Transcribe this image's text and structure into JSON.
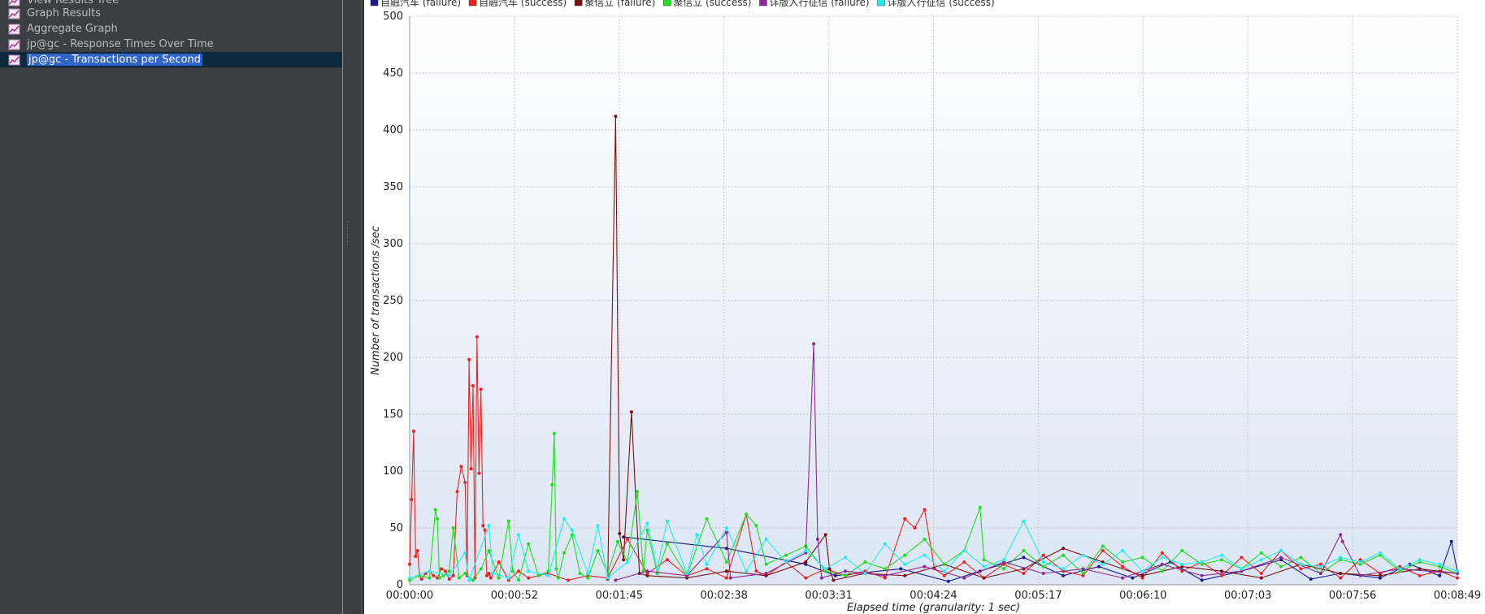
{
  "tree": {
    "items": [
      {
        "label": "View Results Tree",
        "selected": false
      },
      {
        "label": "Graph Results",
        "selected": false
      },
      {
        "label": "Aggregate Graph",
        "selected": false
      },
      {
        "label": "jp@gc - Response Times Over Time",
        "selected": false
      },
      {
        "label": "jp@gc - Transactions per Second",
        "selected": true
      }
    ]
  },
  "chart_data": {
    "type": "line",
    "xlabel": "Elapsed time (granularity: 1 sec)",
    "ylabel": "Number of transactions /sec",
    "ylim": [
      0,
      500
    ],
    "yticks": [
      0,
      50,
      100,
      150,
      200,
      250,
      300,
      350,
      400,
      450,
      500
    ],
    "xlim_seconds": [
      0,
      529
    ],
    "xticks": [
      "00:00:00",
      "00:00:52",
      "00:01:45",
      "00:02:38",
      "00:03:31",
      "00:04:24",
      "00:05:17",
      "00:06:10",
      "00:07:03",
      "00:07:56",
      "00:08:49"
    ],
    "grid": true,
    "legend_position": "top",
    "series": [
      {
        "name": "自融汽车 (failure)",
        "color": "#1a1a8c",
        "x": [
          108,
          160,
          200,
          215,
          248,
          272,
          288,
          310,
          330,
          348,
          365,
          384,
          400,
          420,
          440,
          455,
          470,
          490,
          505,
          520,
          526,
          529
        ],
        "y": [
          42,
          32,
          18,
          8,
          14,
          3,
          12,
          24,
          8,
          16,
          6,
          20,
          4,
          12,
          22,
          5,
          10,
          6,
          18,
          8,
          38,
          12
        ]
      },
      {
        "name": "自融汽车 (success)",
        "color": "#ee2222",
        "x": [
          0,
          1,
          2,
          3,
          4,
          5,
          6,
          8,
          10,
          12,
          14,
          16,
          18,
          20,
          22,
          24,
          26,
          28,
          29,
          30,
          31,
          32,
          33,
          34,
          35,
          36,
          37,
          38,
          39,
          40,
          41,
          45,
          50,
          55,
          60,
          70,
          80,
          90,
          100,
          110,
          120,
          130,
          140,
          150,
          160,
          170,
          175,
          180,
          190,
          200,
          210,
          220,
          230,
          240,
          250,
          255,
          260,
          265,
          270,
          280,
          290,
          300,
          310,
          320,
          330,
          340,
          350,
          360,
          370,
          380,
          390,
          400,
          410,
          420,
          430,
          440,
          450,
          460,
          470,
          480,
          490,
          500,
          510,
          520,
          529
        ],
        "y": [
          18,
          75,
          135,
          25,
          30,
          8,
          5,
          10,
          12,
          8,
          6,
          14,
          12,
          5,
          8,
          82,
          104,
          90,
          8,
          198,
          102,
          175,
          6,
          218,
          98,
          172,
          52,
          48,
          8,
          10,
          6,
          20,
          4,
          12,
          6,
          10,
          4,
          8,
          6,
          40,
          10,
          22,
          8,
          14,
          6,
          62,
          12,
          8,
          20,
          6,
          14,
          8,
          12,
          6,
          58,
          50,
          66,
          14,
          8,
          20,
          6,
          18,
          10,
          26,
          12,
          8,
          30,
          16,
          6,
          28,
          12,
          20,
          8,
          24,
          10,
          30,
          14,
          18,
          6,
          22,
          10,
          16,
          8,
          12,
          6
        ]
      },
      {
        "name": "聚信立 (failure)",
        "color": "#7a1010",
        "x": [
          100,
          104,
          106,
          108,
          112,
          116,
          120,
          140,
          160,
          180,
          200,
          210,
          212,
          214,
          230,
          250,
          270,
          290,
          310,
          330,
          350,
          370,
          390,
          410,
          430,
          450,
          470,
          490,
          510,
          529
        ],
        "y": [
          5,
          412,
          45,
          22,
          152,
          10,
          8,
          6,
          12,
          8,
          20,
          44,
          14,
          4,
          10,
          8,
          18,
          6,
          14,
          32,
          20,
          8,
          16,
          12,
          6,
          18,
          10,
          8,
          14,
          10
        ]
      },
      {
        "name": "聚信立 (success)",
        "color": "#22dd22",
        "x": [
          0,
          5,
          10,
          13,
          14,
          15,
          17,
          20,
          22,
          25,
          28,
          32,
          36,
          40,
          45,
          50,
          52,
          55,
          60,
          65,
          70,
          72,
          73,
          74,
          75,
          78,
          82,
          86,
          90,
          95,
          100,
          105,
          110,
          115,
          118,
          120,
          125,
          130,
          140,
          150,
          160,
          170,
          175,
          180,
          190,
          200,
          210,
          220,
          230,
          240,
          250,
          260,
          270,
          280,
          288,
          290,
          300,
          310,
          320,
          330,
          340,
          350,
          360,
          370,
          380,
          390,
          400,
          410,
          420,
          430,
          440,
          450,
          460,
          470,
          480,
          490,
          500,
          510,
          520,
          529
        ],
        "y": [
          4,
          8,
          6,
          66,
          58,
          6,
          8,
          12,
          50,
          6,
          10,
          4,
          14,
          30,
          6,
          56,
          12,
          4,
          36,
          8,
          12,
          88,
          133,
          14,
          6,
          28,
          44,
          10,
          6,
          30,
          10,
          38,
          20,
          82,
          12,
          48,
          10,
          36,
          8,
          58,
          20,
          62,
          52,
          18,
          26,
          34,
          12,
          8,
          20,
          14,
          26,
          40,
          18,
          30,
          68,
          22,
          14,
          30,
          16,
          26,
          10,
          34,
          20,
          24,
          12,
          30,
          18,
          22,
          14,
          28,
          16,
          24,
          10,
          22,
          18,
          26,
          12,
          20,
          16,
          10
        ]
      },
      {
        "name": "详版人行征信 (failure)",
        "color": "#8e2a94",
        "x": [
          104,
          120,
          140,
          160,
          162,
          180,
          200,
          204,
          206,
          208,
          220,
          240,
          260,
          280,
          300,
          320,
          340,
          360,
          380,
          400,
          420,
          440,
          460,
          470,
          471,
          480,
          500,
          529
        ],
        "y": [
          4,
          12,
          8,
          46,
          6,
          10,
          28,
          212,
          40,
          6,
          12,
          8,
          16,
          6,
          20,
          10,
          14,
          6,
          18,
          8,
          12,
          24,
          10,
          44,
          38,
          8,
          14,
          10
        ]
      },
      {
        "name": "详版人行征信 (success)",
        "color": "#22eeee",
        "x": [
          0,
          10,
          20,
          28,
          30,
          40,
          42,
          50,
          55,
          60,
          70,
          78,
          82,
          90,
          95,
          100,
          110,
          120,
          125,
          130,
          140,
          145,
          150,
          160,
          170,
          180,
          190,
          200,
          210,
          220,
          230,
          240,
          250,
          260,
          270,
          280,
          290,
          300,
          310,
          320,
          330,
          340,
          350,
          360,
          370,
          380,
          390,
          400,
          410,
          420,
          430,
          440,
          450,
          460,
          470,
          480,
          490,
          500,
          510,
          520,
          529
        ],
        "y": [
          6,
          12,
          8,
          28,
          4,
          52,
          10,
          6,
          44,
          12,
          8,
          58,
          48,
          10,
          52,
          6,
          20,
          54,
          14,
          56,
          10,
          44,
          18,
          50,
          12,
          40,
          20,
          30,
          14,
          24,
          10,
          36,
          18,
          26,
          12,
          30,
          16,
          22,
          56,
          20,
          14,
          26,
          18,
          30,
          12,
          24,
          18,
          20,
          26,
          14,
          22,
          30,
          18,
          16,
          24,
          20,
          28,
          14,
          22,
          18,
          12
        ]
      }
    ]
  }
}
